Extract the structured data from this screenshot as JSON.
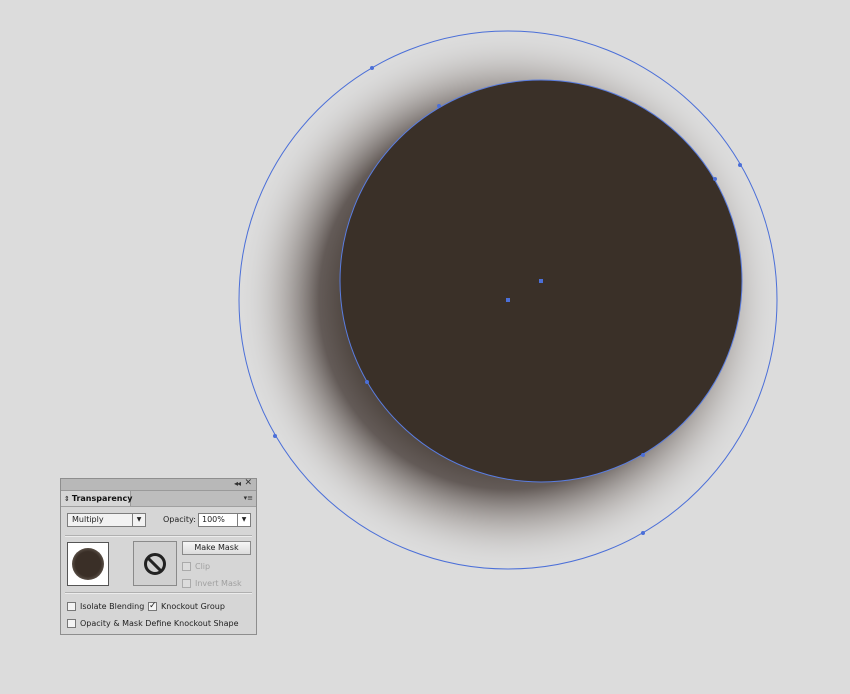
{
  "artwork": {
    "shape": "circle-with-feathered-shadow",
    "fill_color": "#3a3028",
    "selection_color": "#4b6fd8",
    "canvas_color": "#dcdcdc"
  },
  "panel": {
    "title": "Transparency",
    "collapse_glyph": "◂◂",
    "close_glyph": "✕",
    "menu_glyph": "▾≡",
    "blend_mode": "Multiply",
    "opacity_label": "Opacity:",
    "opacity_value": "100%",
    "make_mask_label": "Make Mask",
    "clip_label": "Clip",
    "invert_mask_label": "Invert Mask",
    "isolate_blending_label": "Isolate Blending",
    "knockout_group_label": "Knockout Group",
    "opacity_mask_label": "Opacity & Mask Define Knockout Shape",
    "knockout_group_checked": true,
    "isolate_blending_checked": false,
    "opacity_mask_checked": false,
    "clip_checked": false,
    "invert_mask_checked": false,
    "check_glyph": "✓",
    "sort_icon": "⇕",
    "dropdown_arrow": "▼",
    "no_mask_icon": "no-mask-icon"
  }
}
